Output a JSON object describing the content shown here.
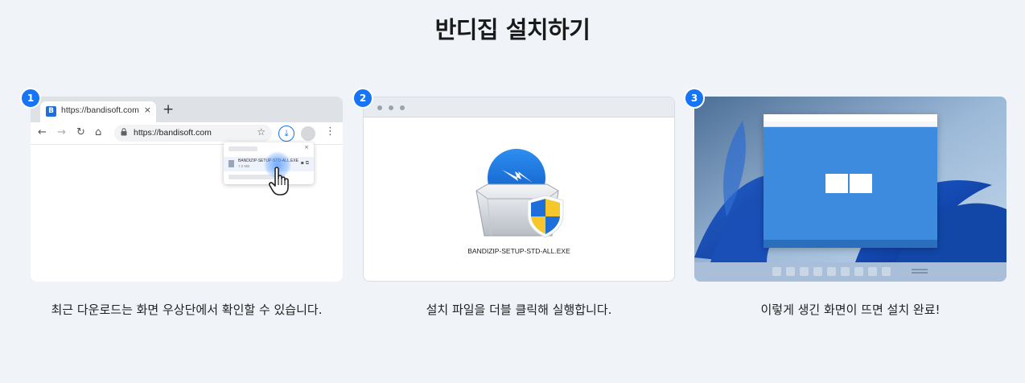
{
  "page": {
    "title": "반디집 설치하기"
  },
  "steps": [
    {
      "number": "1",
      "caption": "최근 다운로드는 화면 우상단에서 확인할 수 있습니다.",
      "browser": {
        "tab_title": "https://bandisoft.com",
        "tab_favicon": "B",
        "tab_close": "×",
        "new_tab": "+",
        "url": "https://bandisoft.com",
        "download_file": "BANDIZIP-SETUP-STD-ALL.EXE",
        "download_size": "7.0 MB"
      }
    },
    {
      "number": "2",
      "caption": "설치 파일을 더블 클릭해 실행합니다.",
      "installer": {
        "file_name": "BANDIZIP-SETUP-STD-ALL.EXE"
      }
    },
    {
      "number": "3",
      "caption": "이렇게 생긴 화면이 뜨면 설치 완료!"
    }
  ],
  "icons": {
    "back": "←",
    "forward": "→",
    "reload": "↻",
    "home": "⌂",
    "lock": "🔒",
    "star": "☆",
    "download": "⤓",
    "menu": "⋮",
    "close": "×",
    "folder": "▪",
    "open": "⧉"
  },
  "colors": {
    "accent": "#1674f5",
    "background": "#f0f3f8",
    "desktop": "#8fb1d8"
  }
}
